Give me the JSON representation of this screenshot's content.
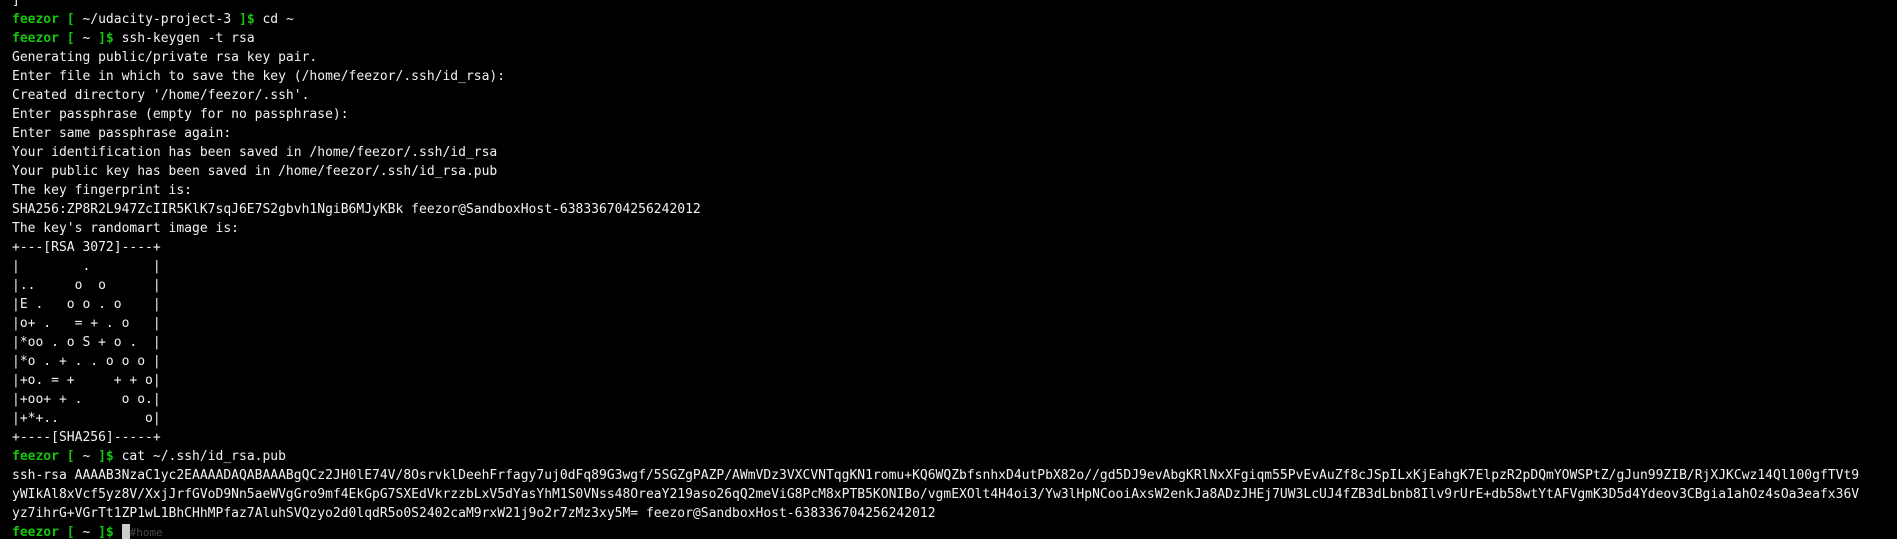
{
  "terminal": {
    "user": "feezor",
    "lines": [
      {
        "kind": "output",
        "text": "]"
      },
      {
        "kind": "prompt",
        "cwd": "~/udacity-project-3",
        "cmd": "cd ~"
      },
      {
        "kind": "prompt",
        "cwd": "~",
        "cmd": "ssh-keygen -t rsa"
      },
      {
        "kind": "output",
        "text": "Generating public/private rsa key pair."
      },
      {
        "kind": "output",
        "text": "Enter file in which to save the key (/home/feezor/.ssh/id_rsa):"
      },
      {
        "kind": "output",
        "text": "Created directory '/home/feezor/.ssh'."
      },
      {
        "kind": "output",
        "text": "Enter passphrase (empty for no passphrase):"
      },
      {
        "kind": "output",
        "text": "Enter same passphrase again:"
      },
      {
        "kind": "output",
        "text": "Your identification has been saved in /home/feezor/.ssh/id_rsa"
      },
      {
        "kind": "output",
        "text": "Your public key has been saved in /home/feezor/.ssh/id_rsa.pub"
      },
      {
        "kind": "output",
        "text": "The key fingerprint is:"
      },
      {
        "kind": "output",
        "text": "SHA256:ZP8R2L947ZcIIR5KlK7sqJ6E7S2gbvh1NgiB6MJyKBk feezor@SandboxHost-638336704256242012"
      },
      {
        "kind": "output",
        "text": "The key's randomart image is:"
      },
      {
        "kind": "output",
        "text": "+---[RSA 3072]----+"
      },
      {
        "kind": "output",
        "text": "|        .        |"
      },
      {
        "kind": "output",
        "text": "|..     o  o      |"
      },
      {
        "kind": "output",
        "text": "|E .   o o . o    |"
      },
      {
        "kind": "output",
        "text": "|o+ .   = + . o   |"
      },
      {
        "kind": "output",
        "text": "|*oo . o S + o .  |"
      },
      {
        "kind": "output",
        "text": "|*o . + . . o o o |"
      },
      {
        "kind": "output",
        "text": "|+o. = +     + + o|"
      },
      {
        "kind": "output",
        "text": "|+oo+ + .     o o.|"
      },
      {
        "kind": "output",
        "text": "|+*+..           o|"
      },
      {
        "kind": "output",
        "text": "+----[SHA256]-----+"
      },
      {
        "kind": "prompt",
        "cwd": "~",
        "cmd": "cat ~/.ssh/id_rsa.pub"
      },
      {
        "kind": "output",
        "text": "ssh-rsa AAAAB3NzaC1yc2EAAAADAQABAAABgQCz2JH0lE74V/8OsrvklDeehFrfagy7uj0dFq89G3wgf/5SGZgPAZP/AWmVDz3VXCVNTqgKN1romu+KQ6WQZbfsnhxD4utPbX82o//gd5DJ9evAbgKRlNxXFgiqm55PvEvAuZf8cJSpILxKjEahgK7ElpzR2pDQmYOWSPtZ/gJun99ZIB/RjXJKCwz14Ql100gfTVt9"
      },
      {
        "kind": "output",
        "text": "yWIkAl8xVcf5yz8V/XxjJrfGVoD9Nn5aeWVgGro9mf4EkGpG7SXEdVkrzzbLxV5dYasYhM1S0VNss48OreaY219aso26qQ2meViG8PcM8xPTB5KONIBo/vgmEXOlt4H4oi3/Yw3lHpNCooiAxsW2enkJa8ADzJHEj7UW3LcUJ4fZB3dLbnb8Ilv9rUrE+db58wtYtAFVgmK3D5d4Ydeov3CBgia1ahOz4sOa3eafx36V"
      },
      {
        "kind": "output",
        "text": "yz7ihrG+VGrTt1ZP1wL1BhCHhMPfaz7AluhSVQzyo2d0lqdR5o0S2402caM9rxW21j9o2r7zMz3xy5M= feezor@SandboxHost-638336704256242012"
      },
      {
        "kind": "prompt_active",
        "cwd": "~",
        "cmd": "",
        "ghost": "#home"
      }
    ]
  }
}
